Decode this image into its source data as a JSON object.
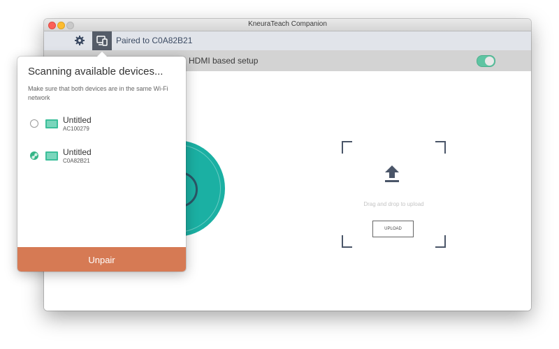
{
  "window": {
    "title": "KneuraTeach Companion"
  },
  "toolbar": {
    "settings_icon": "gear-icon",
    "device_icon": "device-pair-icon",
    "paired_label": "Paired to C0A82B21"
  },
  "subbar": {
    "setup_label": "HDMI based setup",
    "toggle_on": true
  },
  "upload": {
    "icon": "upload-arrow-icon",
    "hint": "Drag and drop to upload",
    "button_label": "UPLOAD"
  },
  "popover": {
    "title": "Scanning available devices...",
    "subtitle": "Make sure that both devices are in the same Wi-Fi network",
    "devices": [
      {
        "name": "Untitled",
        "id": "AC100279",
        "selected": false
      },
      {
        "name": "Untitled",
        "id": "C0A82B21",
        "selected": true
      }
    ],
    "unpair_label": "Unpair"
  },
  "colors": {
    "accent_teal": "#1bb0a3",
    "toggle_green": "#5ec4a2",
    "unpair_orange": "#d67a54",
    "device_button_dark": "#555c68"
  }
}
